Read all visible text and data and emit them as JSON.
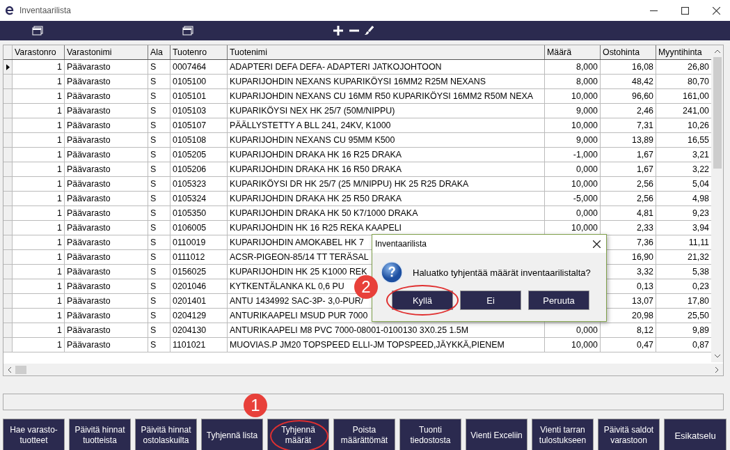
{
  "window": {
    "title": "Inventaarilista"
  },
  "table": {
    "columns": [
      "Varastonro",
      "Varastonimi",
      "Ala",
      "Tuotenro",
      "Tuotenimi",
      "Määrä",
      "Ostohinta",
      "Myyntihinta"
    ],
    "rows": [
      {
        "selected": true,
        "cells": [
          "1",
          "Päävarasto",
          "S",
          "0007464",
          "ADAPTERI DEFA DEFA- ADAPTERI JATKOJOHTOON",
          "8,000",
          "16,08",
          "26,80"
        ]
      },
      {
        "selected": false,
        "cells": [
          "1",
          "Päävarasto",
          "S",
          "0105100",
          "KUPARIJOHDIN NEXANS KUPARIKÖYSI 16MM2 R25M NEXANS",
          "8,000",
          "48,42",
          "80,70"
        ]
      },
      {
        "selected": false,
        "cells": [
          "1",
          "Päävarasto",
          "S",
          "0105101",
          "KUPARIJOHDIN NEXANS CU 16MM R50 KUPARIKÖYSI 16MM2 R50M NEXA",
          "10,000",
          "96,60",
          "161,00"
        ]
      },
      {
        "selected": false,
        "cells": [
          "1",
          "Päävarasto",
          "S",
          "0105103",
          "KUPARIKÖYSI NEX HK 25/7 (50M/NIPPU)",
          "9,000",
          "2,46",
          "241,00"
        ]
      },
      {
        "selected": false,
        "cells": [
          "1",
          "Päävarasto",
          "S",
          "0105107",
          "PÄÄLLYSTETTY A BLL 241, 24KV, K1000",
          "10,000",
          "7,31",
          "10,26"
        ]
      },
      {
        "selected": false,
        "cells": [
          "1",
          "Päävarasto",
          "S",
          "0105108",
          "KUPARIJOHDIN NEXANS CU 95MM K500",
          "9,000",
          "13,89",
          "16,55"
        ]
      },
      {
        "selected": false,
        "cells": [
          "1",
          "Päävarasto",
          "S",
          "0105205",
          "KUPARIJOHDIN DRAKA HK 16 R25 DRAKA",
          "-1,000",
          "1,67",
          "3,21"
        ]
      },
      {
        "selected": false,
        "cells": [
          "1",
          "Päävarasto",
          "S",
          "0105206",
          "KUPARIJOHDIN DRAKA HK 16 R50 DRAKA",
          "0,000",
          "1,67",
          "3,22"
        ]
      },
      {
        "selected": false,
        "cells": [
          "1",
          "Päävarasto",
          "S",
          "0105323",
          "KUPARIKÖYSI DR HK 25/7 (25 M/NIPPU) HK 25 R25 DRAKA",
          "10,000",
          "2,56",
          "5,04"
        ]
      },
      {
        "selected": false,
        "cells": [
          "1",
          "Päävarasto",
          "S",
          "0105324",
          "KUPARIJOHDIN DRAKA HK 25 R50 DRAKA",
          "-5,000",
          "2,56",
          "4,98"
        ]
      },
      {
        "selected": false,
        "cells": [
          "1",
          "Päävarasto",
          "S",
          "0105350",
          "KUPARIJOHDIN DRAKA HK 50 K7/1000 DRAKA",
          "0,000",
          "4,81",
          "9,23"
        ]
      },
      {
        "selected": false,
        "cells": [
          "1",
          "Päävarasto",
          "S",
          "0106005",
          "KUPARIJOHDIN HK 16 R25 REKA KAAPELI",
          "10,000",
          "2,33",
          "3,94"
        ]
      },
      {
        "selected": false,
        "cells": [
          "1",
          "Päävarasto",
          "S",
          "0110019",
          "KUPARIJOHDIN AMOKABEL HK 7",
          "",
          "7,36",
          "11,11"
        ]
      },
      {
        "selected": false,
        "cells": [
          "1",
          "Päävarasto",
          "S",
          "0111012",
          "ACSR-PIGEON-85/14 TT TERÄSAL",
          "",
          "16,90",
          "21,32"
        ]
      },
      {
        "selected": false,
        "cells": [
          "1",
          "Päävarasto",
          "S",
          "0156025",
          "KUPARIJOHDIN HK 25 K1000 REK",
          "",
          "3,32",
          "5,38"
        ]
      },
      {
        "selected": false,
        "cells": [
          "1",
          "Päävarasto",
          "S",
          "0201046",
          "KYTKENTÄLANKA KL 0,6 PU",
          "",
          "0,13",
          "0,23"
        ]
      },
      {
        "selected": false,
        "cells": [
          "1",
          "Päävarasto",
          "S",
          "0201401",
          "ANTU 1434992 SAC-3P- 3,0-PUR/",
          "",
          "13,07",
          "17,80"
        ]
      },
      {
        "selected": false,
        "cells": [
          "1",
          "Päävarasto",
          "S",
          "0204129",
          "ANTURIKAAPELI MSUD PUR 7000",
          "",
          "20,98",
          "25,50"
        ]
      },
      {
        "selected": false,
        "cells": [
          "1",
          "Päävarasto",
          "S",
          "0204130",
          "ANTURIKAAPELI M8 PVC 7000-08001-0100130 3X0.25 1.5M",
          "0,000",
          "8,12",
          "9,89"
        ]
      },
      {
        "selected": false,
        "cells": [
          "1",
          "Päävarasto",
          "S",
          "1101021",
          "MUOVIAS.P JM20 TOPSPEED ELLI-JM TOPSPEED,JÄYKKÄ,PIENEM",
          "10,000",
          "0,47",
          "0,87"
        ]
      }
    ]
  },
  "buttons": [
    {
      "label": "Hae varasto-\ntuotteet",
      "highlighted": false
    },
    {
      "label": "Päivitä hinnat\ntuotteista",
      "highlighted": false
    },
    {
      "label": "Päivitä hinnat\nostolaskuilta",
      "highlighted": false
    },
    {
      "label": "Tyhjennä lista",
      "highlighted": false
    },
    {
      "label": "Tyhjennä\nmäärät",
      "highlighted": true,
      "step": "1"
    },
    {
      "label": "Poista\nmäärättömät",
      "highlighted": false
    },
    {
      "label": "Tuonti\ntiedostosta",
      "highlighted": false
    },
    {
      "label": "Vienti Exceliin",
      "highlighted": false
    },
    {
      "label": "Vienti tarran\ntulostukseen",
      "highlighted": false
    },
    {
      "label": "Päivitä saldot\nvarastoon",
      "highlighted": false
    },
    {
      "label": "Esikatselu",
      "highlighted": false
    }
  ],
  "dialog": {
    "title": "Inventaarilista",
    "message": "Haluatko tyhjentää määrät inventaarilistalta?",
    "buttons": [
      {
        "label": "Kyllä",
        "highlighted": true,
        "step": "2"
      },
      {
        "label": "Ei",
        "highlighted": false
      },
      {
        "label": "Peruuta",
        "highlighted": false
      }
    ]
  }
}
